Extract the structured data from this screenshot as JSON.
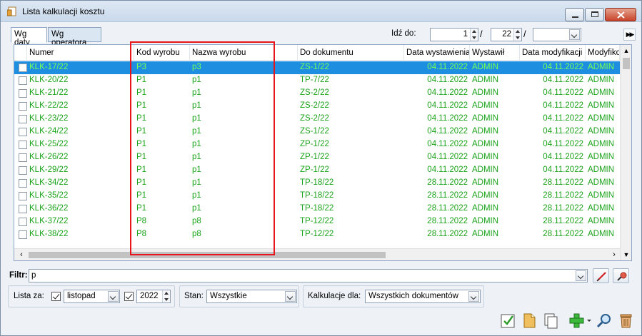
{
  "window": {
    "title": "Lista kalkulacji kosztu"
  },
  "tabs": [
    {
      "label": "Wg daty"
    },
    {
      "label": "Wg operatora"
    }
  ],
  "goto": {
    "label": "Idź do:",
    "day": "1",
    "month": "22",
    "year": ""
  },
  "grid": {
    "columns": [
      "Numer",
      "Kod wyrobu",
      "Nazwa wyrobu",
      "Do dokumentu",
      "Data wystawienia",
      "Wystawił",
      "Data modyfikacji",
      "Modyfikow"
    ],
    "rows": [
      [
        "KLK-17/22",
        "P3",
        "p3",
        "ZS-1/22",
        "04.11.2022",
        "ADMIN",
        "04.11.2022",
        "ADMIN"
      ],
      [
        "KLK-20/22",
        "P1",
        "p1",
        "TP-7/22",
        "04.11.2022",
        "ADMIN",
        "04.11.2022",
        "ADMIN"
      ],
      [
        "KLK-21/22",
        "P1",
        "p1",
        "ZS-2/22",
        "04.11.2022",
        "ADMIN",
        "04.11.2022",
        "ADMIN"
      ],
      [
        "KLK-22/22",
        "P1",
        "p1",
        "ZS-2/22",
        "04.11.2022",
        "ADMIN",
        "04.11.2022",
        "ADMIN"
      ],
      [
        "KLK-23/22",
        "P1",
        "p1",
        "ZS-2/22",
        "04.11.2022",
        "ADMIN",
        "04.11.2022",
        "ADMIN"
      ],
      [
        "KLK-24/22",
        "P1",
        "p1",
        "ZS-1/22",
        "04.11.2022",
        "ADMIN",
        "04.11.2022",
        "ADMIN"
      ],
      [
        "KLK-25/22",
        "P1",
        "p1",
        "ZP-1/22",
        "04.11.2022",
        "ADMIN",
        "04.11.2022",
        "ADMIN"
      ],
      [
        "KLK-26/22",
        "P1",
        "p1",
        "ZP-1/22",
        "04.11.2022",
        "ADMIN",
        "04.11.2022",
        "ADMIN"
      ],
      [
        "KLK-29/22",
        "P1",
        "p1",
        "ZP-1/22",
        "04.11.2022",
        "ADMIN",
        "04.11.2022",
        "ADMIN"
      ],
      [
        "KLK-34/22",
        "P1",
        "p1",
        "TP-18/22",
        "28.11.2022",
        "ADMIN",
        "28.11.2022",
        "ADMIN"
      ],
      [
        "KLK-35/22",
        "P1",
        "p1",
        "TP-18/22",
        "28.11.2022",
        "ADMIN",
        "28.11.2022",
        "ADMIN"
      ],
      [
        "KLK-36/22",
        "P1",
        "p1",
        "TP-18/22",
        "28.11.2022",
        "ADMIN",
        "28.11.2022",
        "ADMIN"
      ],
      [
        "KLK-37/22",
        "P8",
        "p8",
        "TP-12/22",
        "28.11.2022",
        "ADMIN",
        "28.11.2022",
        "ADMIN"
      ],
      [
        "KLK-38/22",
        "P8",
        "p8",
        "TP-12/22",
        "28.11.2022",
        "ADMIN",
        "28.11.2022",
        "ADMIN"
      ]
    ],
    "selected_row": 0
  },
  "filter": {
    "label": "Filtr:",
    "value": "p"
  },
  "lista_za": {
    "label": "Lista za:",
    "month": "listopad",
    "year": "2022"
  },
  "stan": {
    "label": "Stan:",
    "value": "Wszystkie"
  },
  "kalkulacje": {
    "label": "Kalkulacje dla:",
    "value": "Wszystkich dokumentów"
  },
  "colors": {
    "row_text": "#1aa31a",
    "selection": "#1e8fe0",
    "highlight_box": "#e8141c"
  },
  "icons": [
    "document-icon",
    "minimize-icon",
    "maximize-icon",
    "close-icon",
    "fast-forward-icon",
    "clear-filter-icon",
    "filter-settings-icon",
    "confirm-icon",
    "new-document-icon",
    "copy-icon",
    "add-icon",
    "search-icon",
    "trash-icon"
  ]
}
